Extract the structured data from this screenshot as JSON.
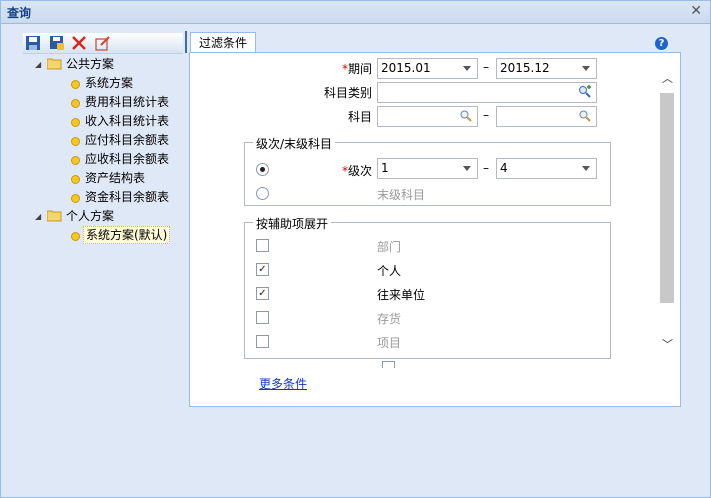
{
  "window": {
    "title": "查询",
    "close_icon": "close-icon"
  },
  "toolbar": {
    "icons": [
      "save-icon",
      "save-as-icon",
      "delete-icon",
      "edit-icon"
    ]
  },
  "tree": {
    "public": {
      "label": "公共方案",
      "items": [
        "系统方案",
        "费用科目统计表",
        "收入科目统计表",
        "应付科目余额表",
        "应收科目余额表",
        "资产结构表",
        "资金科目余额表"
      ]
    },
    "personal": {
      "label": "个人方案",
      "items": [
        "系统方案(默认)"
      ]
    }
  },
  "tab": {
    "label": "过滤条件"
  },
  "form": {
    "period": {
      "label": "期间",
      "from": "2015.01",
      "to": "2015.12",
      "sep": "–"
    },
    "category": {
      "label": "科目类别",
      "value": ""
    },
    "subject": {
      "label": "科目",
      "from": "",
      "to": "",
      "sep": "–"
    },
    "level_group": {
      "legend": "级次/末级科目",
      "level": {
        "label": "级次",
        "from": "1",
        "to": "4",
        "sep": "–",
        "selected": true
      },
      "leaf": {
        "label": "末级科目",
        "selected": false
      }
    },
    "aux_group": {
      "legend": "按辅助项展开",
      "items": [
        {
          "label": "部门",
          "checked": false,
          "enabled": false
        },
        {
          "label": "个人",
          "checked": true,
          "enabled": true
        },
        {
          "label": "往来单位",
          "checked": true,
          "enabled": true
        },
        {
          "label": "存货",
          "checked": false,
          "enabled": false
        },
        {
          "label": "项目",
          "checked": false,
          "enabled": false
        }
      ]
    },
    "more": "更多条件"
  }
}
